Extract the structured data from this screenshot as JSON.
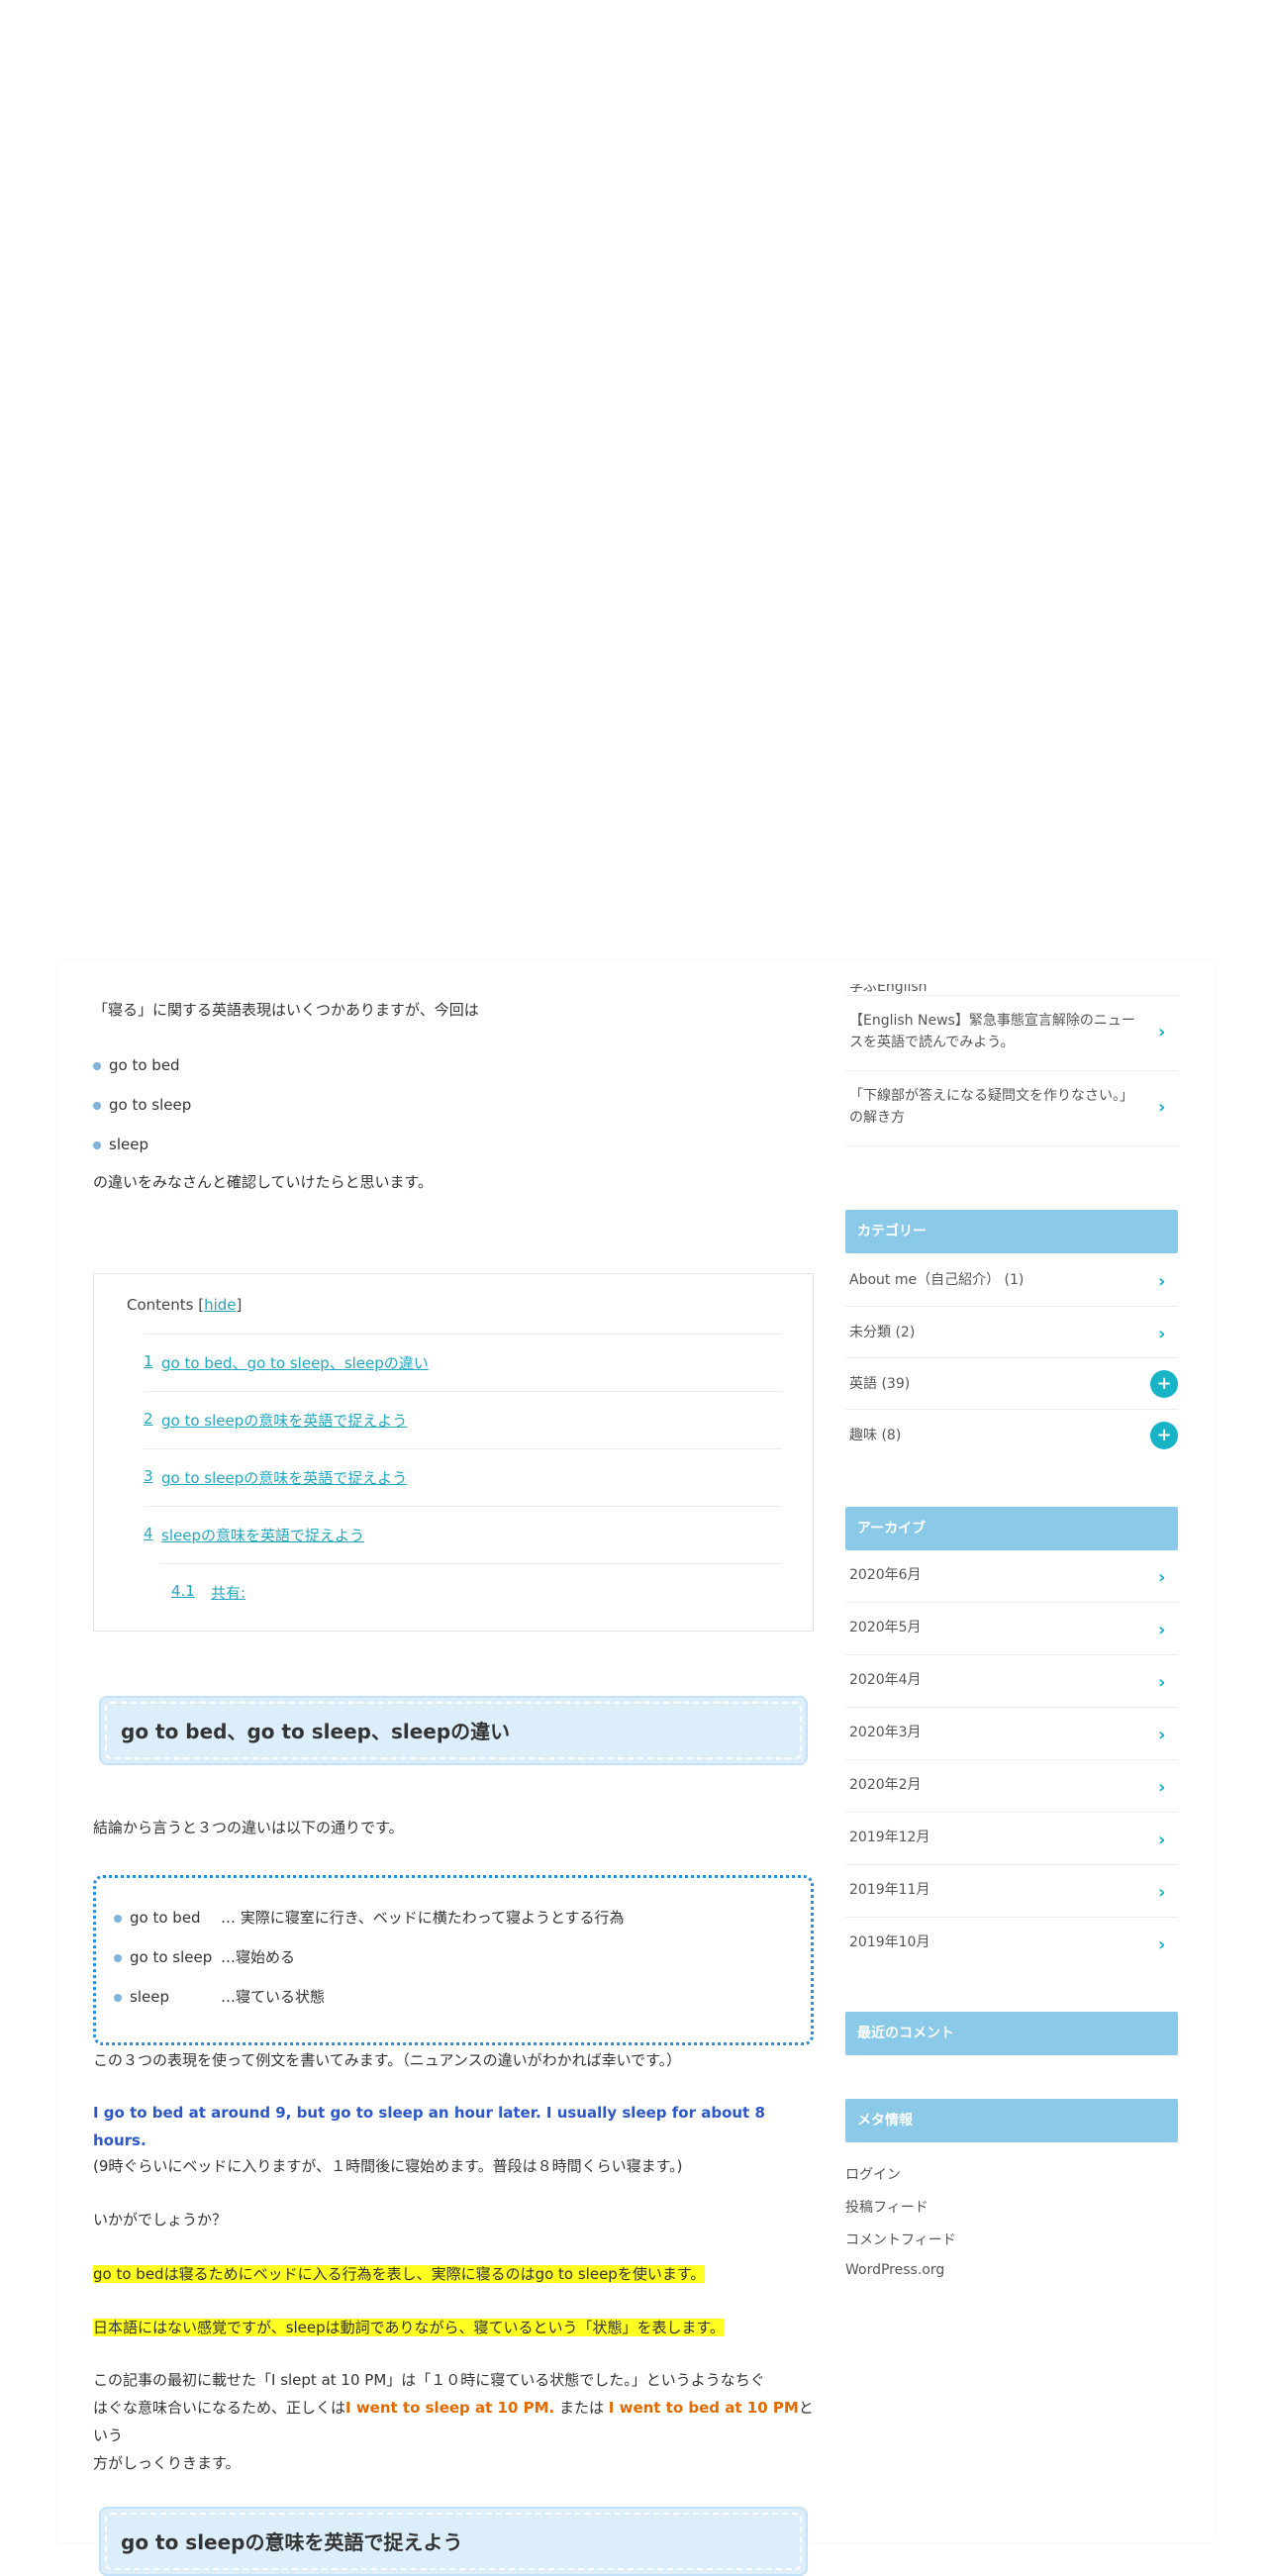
{
  "article": {
    "intro": "「寝る」に関する英語表現はいくつかありますが、今回は",
    "bullets": [
      "go to bed",
      "go to sleep",
      "sleep"
    ],
    "after_bullets": "の違いをみなさんと確認していけたらと思います。",
    "toc": {
      "title": "Contents [",
      "hide": "hide",
      "close": "]",
      "items": [
        {
          "num": "1",
          "label": "go to bed、go to sleep、sleepの違い"
        },
        {
          "num": "2",
          "label": "go to sleepの意味を英語で捉えよう"
        },
        {
          "num": "3",
          "label": "go to sleepの意味を英語で捉えよう"
        },
        {
          "num": "4",
          "label": "sleepの意味を英語で捉えよう"
        },
        {
          "num": "4.1",
          "label": "共有:"
        }
      ]
    },
    "h2_first": "go to bed、go to sleep、sleepの違い",
    "conclusion": "結論から言うと３つの違いは以下の通りです。",
    "summary": [
      {
        "term": "go to bed",
        "desc": "… 実際に寝室に行き、ベッドに横たわって寝ようとする行為"
      },
      {
        "term": "go to sleep",
        "desc": "…寝始める"
      },
      {
        "term": "sleep",
        "desc": "…寝ている状態"
      }
    ],
    "example_intro": "この３つの表現を使って例文を書いてみます。（ニュアンスの違いがわかれば幸いです。）",
    "example_en": "I go to bed at around 9, but go to sleep an hour later. I usually sleep for about 8 hours.",
    "example_ja": "(9時ぐらいにベッドに入りますが、１時間後に寝始めます。普段は８時間くらい寝ます。)",
    "question": "いかがでしょうか？",
    "highlight1": "go to bedは寝るためにベッドに入る行為を表し、実際に寝るのはgo to sleepを使います。",
    "highlight2": "日本語にはない感覚ですが、sleepは動詞でありながら、寝ているという「状態」を表します。",
    "closing_1": "この記事の最初に載せた「I slept at 10 PM」は「１０時に寝ている状態でした。」というようなちぐ",
    "closing_2a": "はぐな意味合いになるため、正しくは",
    "closing_orange1": "I went to sleep at 10 PM.",
    "closing_mid": " または ",
    "closing_orange2": "I went to bed at 10 PM",
    "closing_2b": "という",
    "closing_3": "方がしっくりきます。",
    "h2_second": "go to sleepの意味を英語で捉えよう"
  },
  "sidebar": {
    "recent_cut": "学ぶEnglish",
    "recent_posts": [
      "【English News】緊急事態宣言解除のニュースを英語で読んでみよう。",
      "「下線部が答えになる疑問文を作りなさい。」の解き方"
    ],
    "categories_title": "カテゴリー",
    "categories": [
      {
        "label": "About me（自己紹介） (1)",
        "expand": false
      },
      {
        "label": "未分類 (2)",
        "expand": false
      },
      {
        "label": "英語 (39)",
        "expand": true
      },
      {
        "label": "趣味 (8)",
        "expand": true
      }
    ],
    "archives_title": "アーカイブ",
    "archives": [
      "2020年6月",
      "2020年5月",
      "2020年4月",
      "2020年3月",
      "2020年2月",
      "2019年12月",
      "2019年11月",
      "2019年10月"
    ],
    "recent_comments_title": "最近のコメント",
    "meta_title": "メタ情報",
    "meta_links": [
      "ログイン",
      "投稿フィード",
      "コメントフィード",
      "WordPress.org"
    ]
  }
}
